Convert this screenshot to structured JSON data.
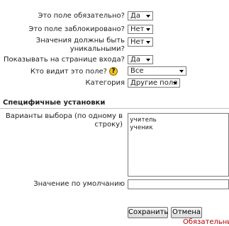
{
  "fields": [
    {
      "label": "Это поле обязательно?",
      "value": "Да"
    },
    {
      "label": "Это поле заблокировано?",
      "value": "Нет"
    },
    {
      "label_line1": "Значения должны быть",
      "label_line2": "уникальными?",
      "value": "Нет"
    },
    {
      "label": "Показывать на странице входа?",
      "value": "Да"
    },
    {
      "label": "Кто видит это поле?",
      "value": "Все",
      "help_icon": "question-help-icon"
    },
    {
      "label": "Категория",
      "value": "Другие поля"
    }
  ],
  "section": {
    "title": "Специфичные установки"
  },
  "choices": {
    "label_line1": "Варианты выбора (по одному в",
    "label_line2": "строку)",
    "value": "учитель\nученик"
  },
  "default": {
    "label": "Значение по умолчанию",
    "value": ""
  },
  "buttons": {
    "save": "Сохранить",
    "cancel": "Отмена"
  },
  "required_note": "Обязательные"
}
